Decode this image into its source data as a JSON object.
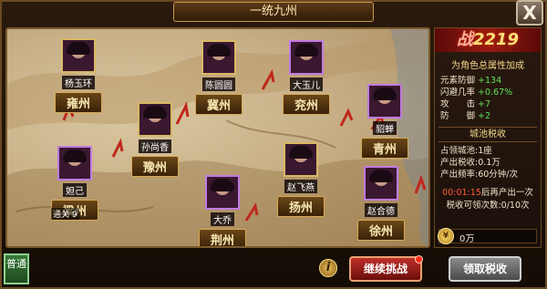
{
  "title": "一统九州",
  "close_label": "X",
  "regions": [
    {
      "id": "yongzhou",
      "city": "雍州",
      "hero": "杨玉环"
    },
    {
      "id": "jizhou",
      "city": "冀州",
      "hero": "陈圆圆"
    },
    {
      "id": "yanzhou",
      "city": "兖州",
      "hero": "大玉儿"
    },
    {
      "id": "yuzhou",
      "city": "豫州",
      "hero": "孙尚香"
    },
    {
      "id": "qingzhou",
      "city": "青州",
      "hero": "貂蝉"
    },
    {
      "id": "liangzhou",
      "city": "梁州",
      "hero": "妲己"
    },
    {
      "id": "jingzhou",
      "city": "荆州",
      "hero": "大乔"
    },
    {
      "id": "yangzhou",
      "city": "扬州",
      "hero": "赵飞燕"
    },
    {
      "id": "xuzhou",
      "city": "徐州",
      "hero": "赵合德"
    }
  ],
  "attacking_label": "通关",
  "attacking_count": "9",
  "panel": {
    "power_char": "战",
    "power_value": "2219",
    "bonus_head": "为角色总属性加成",
    "stats": [
      {
        "label": "元素防御",
        "value": "+134"
      },
      {
        "label": "闪避几率",
        "value": "+0.67%"
      },
      {
        "label": "攻　　击",
        "value": "+7"
      },
      {
        "label": "防　　御",
        "value": "+2"
      }
    ],
    "tax_head": "城池税收",
    "tax_rows": [
      {
        "label": "占领城池:",
        "value": "1座"
      },
      {
        "label": "产出税收:",
        "value": "0.1万"
      },
      {
        "label": "产出频率:",
        "value": "60分钟/次"
      }
    ],
    "timer": "00:01:15",
    "timer_suffix": "后再产出一次",
    "count_label": "税收可领次数:",
    "count_value": "0/10次",
    "coin_value": "0万"
  },
  "mode_label": "普通",
  "info_label": "i",
  "challenge_label": "继续挑战",
  "collect_label": "领取税收"
}
